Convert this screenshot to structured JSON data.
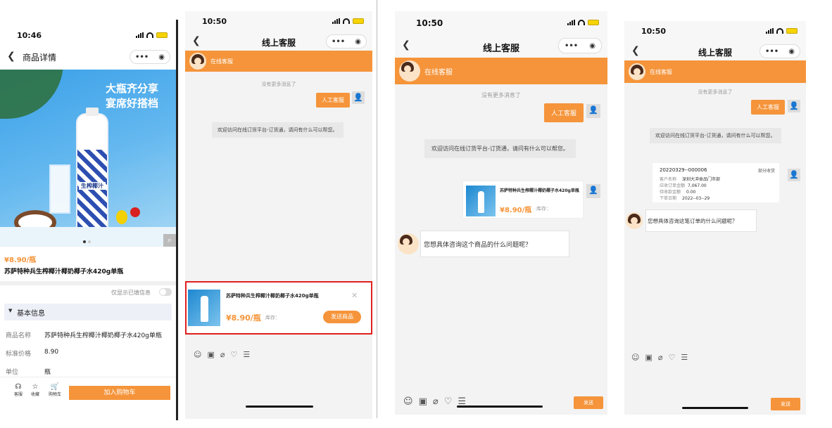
{
  "p1": {
    "time": "10:46",
    "nav_title": "商品详情",
    "banner_line1": "大瓶齐分享",
    "banner_line2": "宴席好搭档",
    "bottle_text": "生榨椰汁",
    "price": "¥8.90/瓶",
    "product_name": "苏萨特种兵生榨椰汁椰奶椰子水420g单瓶",
    "toggle_label": "仅显示已填信息",
    "section_title": "基本信息",
    "rows": [
      {
        "k": "商品名称",
        "v": "苏萨特种兵生榨椰汁椰奶椰子水420g单瓶"
      },
      {
        "k": "标准价格",
        "v": "8.90"
      },
      {
        "k": "单位",
        "v": "瓶"
      }
    ],
    "tab_service": "客服",
    "tab_fav": "收藏",
    "tab_cart": "购物车",
    "add_cart": "加入购物车"
  },
  "p2": {
    "time": "10:50",
    "nav_title": "线上客服",
    "agent_name": "在线客服",
    "no_more": "没有更多消息了",
    "user_msg": "人工客服",
    "welcome": "欢迎访问在线订货平台-订货通，请问有什么可以帮您。",
    "product_title": "苏萨特种兵生榨椰汁椰奶椰子水420g单瓶",
    "price": "¥8.90/瓶",
    "stock": "库存：",
    "send_product": "发送商品",
    "close": "✕"
  },
  "p3": {
    "time": "10:50",
    "nav_title": "线上客服",
    "agent_name": "在线客服",
    "no_more": "没有更多消息了",
    "user_msg": "人工客服",
    "welcome": "欢迎访问在线订货平台-订货通，请问有什么可以帮您。",
    "product_title": "苏萨特种兵生榨椰汁椰奶椰子水420g单瓶",
    "price": "¥8.90/瓶",
    "stock": "库存：",
    "agent_reply": "您想具体咨询这个商品的什么问题呢？",
    "send": "发送"
  },
  "p4": {
    "time": "10:50",
    "nav_title": "线上客服",
    "agent_name": "在线客服",
    "no_more": "没有更多消息了",
    "user_msg": "人工客服",
    "welcome": "欢迎访问在线订货平台-订货通，请问有什么可以帮您。",
    "order_no": "20220329--000006",
    "order_status": "部分收货",
    "order_rows": [
      {
        "k": "客户名称",
        "v": "深圳大冲食品门市部"
      },
      {
        "k": "应收订单金额",
        "v": "7,067.00"
      },
      {
        "k": "待收款金额",
        "v": "0.00"
      },
      {
        "k": "下单日期",
        "v": "2022--03--29"
      }
    ],
    "agent_reply": "您想具体咨询这笔订单的什么问题呢？",
    "send": "发送"
  },
  "common": {
    "toolbar_icons": [
      "☺",
      "▣",
      "⌀",
      "♡",
      "☰"
    ],
    "capsule_dots": "•••",
    "capsule_circle": "◉",
    "user_icon": "👤"
  },
  "colors": {
    "accent": "#f5943a",
    "highlight": "#e02020"
  }
}
